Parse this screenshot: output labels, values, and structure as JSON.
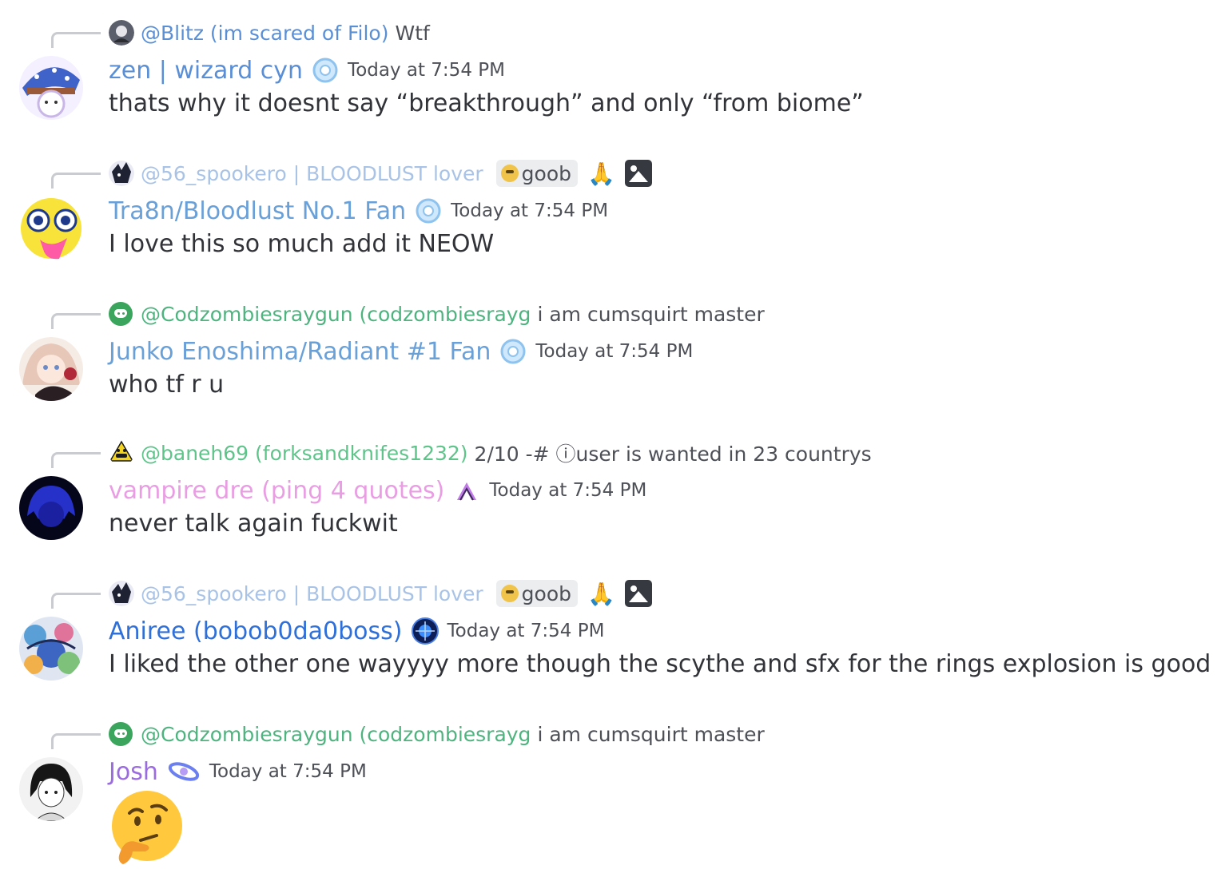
{
  "messages": [
    {
      "reply": {
        "name": "@Blitz (im scared of Filo)",
        "text": "Wtf",
        "name_color": "#5a8fd6"
      },
      "username": "zen | wizard cyn",
      "username_color": "#5a8fd6",
      "timestamp": "Today at 7:54 PM",
      "content": "thats why it doesnt say “breakthrough” and only “from biome”"
    },
    {
      "reply": {
        "name": "@56_spookero | BLOODLUST lover",
        "tag": "goob",
        "emoji": "🙏",
        "name_color": "#a9c3e6"
      },
      "username": "Tra8n/Bloodlust No.1 Fan",
      "username_color": "#6aa0d8",
      "timestamp": "Today at 7:54 PM",
      "content": "I love this so much add it NEOW"
    },
    {
      "reply": {
        "name": "@Codzombiesraygun (codzombiesrayg",
        "text": "i am cumsquirt master",
        "name_color": "#4fb37f"
      },
      "username": "Junko Enoshima/Radiant #1 Fan",
      "username_color": "#6aa0d8",
      "timestamp": "Today at 7:54 PM",
      "content": "who tf r u"
    },
    {
      "reply": {
        "name": "@baneh69 (forksandknifes1232)",
        "text": "2/10 -# ⓘuser is wanted in 23 countrys",
        "name_color": "#5ec48a"
      },
      "username": "vampire dre (ping 4 quotes)",
      "username_color": "#e99ee3",
      "timestamp": "Today at 7:54 PM",
      "content": "never talk again fuckwit"
    },
    {
      "reply": {
        "name": "@56_spookero | BLOODLUST lover",
        "tag": "goob",
        "emoji": "🙏",
        "name_color": "#a9c3e6"
      },
      "username": "Aniree (bobob0da0boss)",
      "username_color": "#2f6fd8",
      "timestamp": "Today at 7:54 PM",
      "content": "I liked the other one wayyyy more though the scythe and sfx for the rings explosion is good"
    },
    {
      "reply": {
        "name": "@Codzombiesraygun (codzombiesrayg",
        "text": "i am cumsquirt master",
        "name_color": "#4fb37f"
      },
      "username": "Josh",
      "username_color": "#9b6cdf",
      "timestamp": "Today at 7:54 PM",
      "content_emoji": "thinking-face"
    }
  ]
}
